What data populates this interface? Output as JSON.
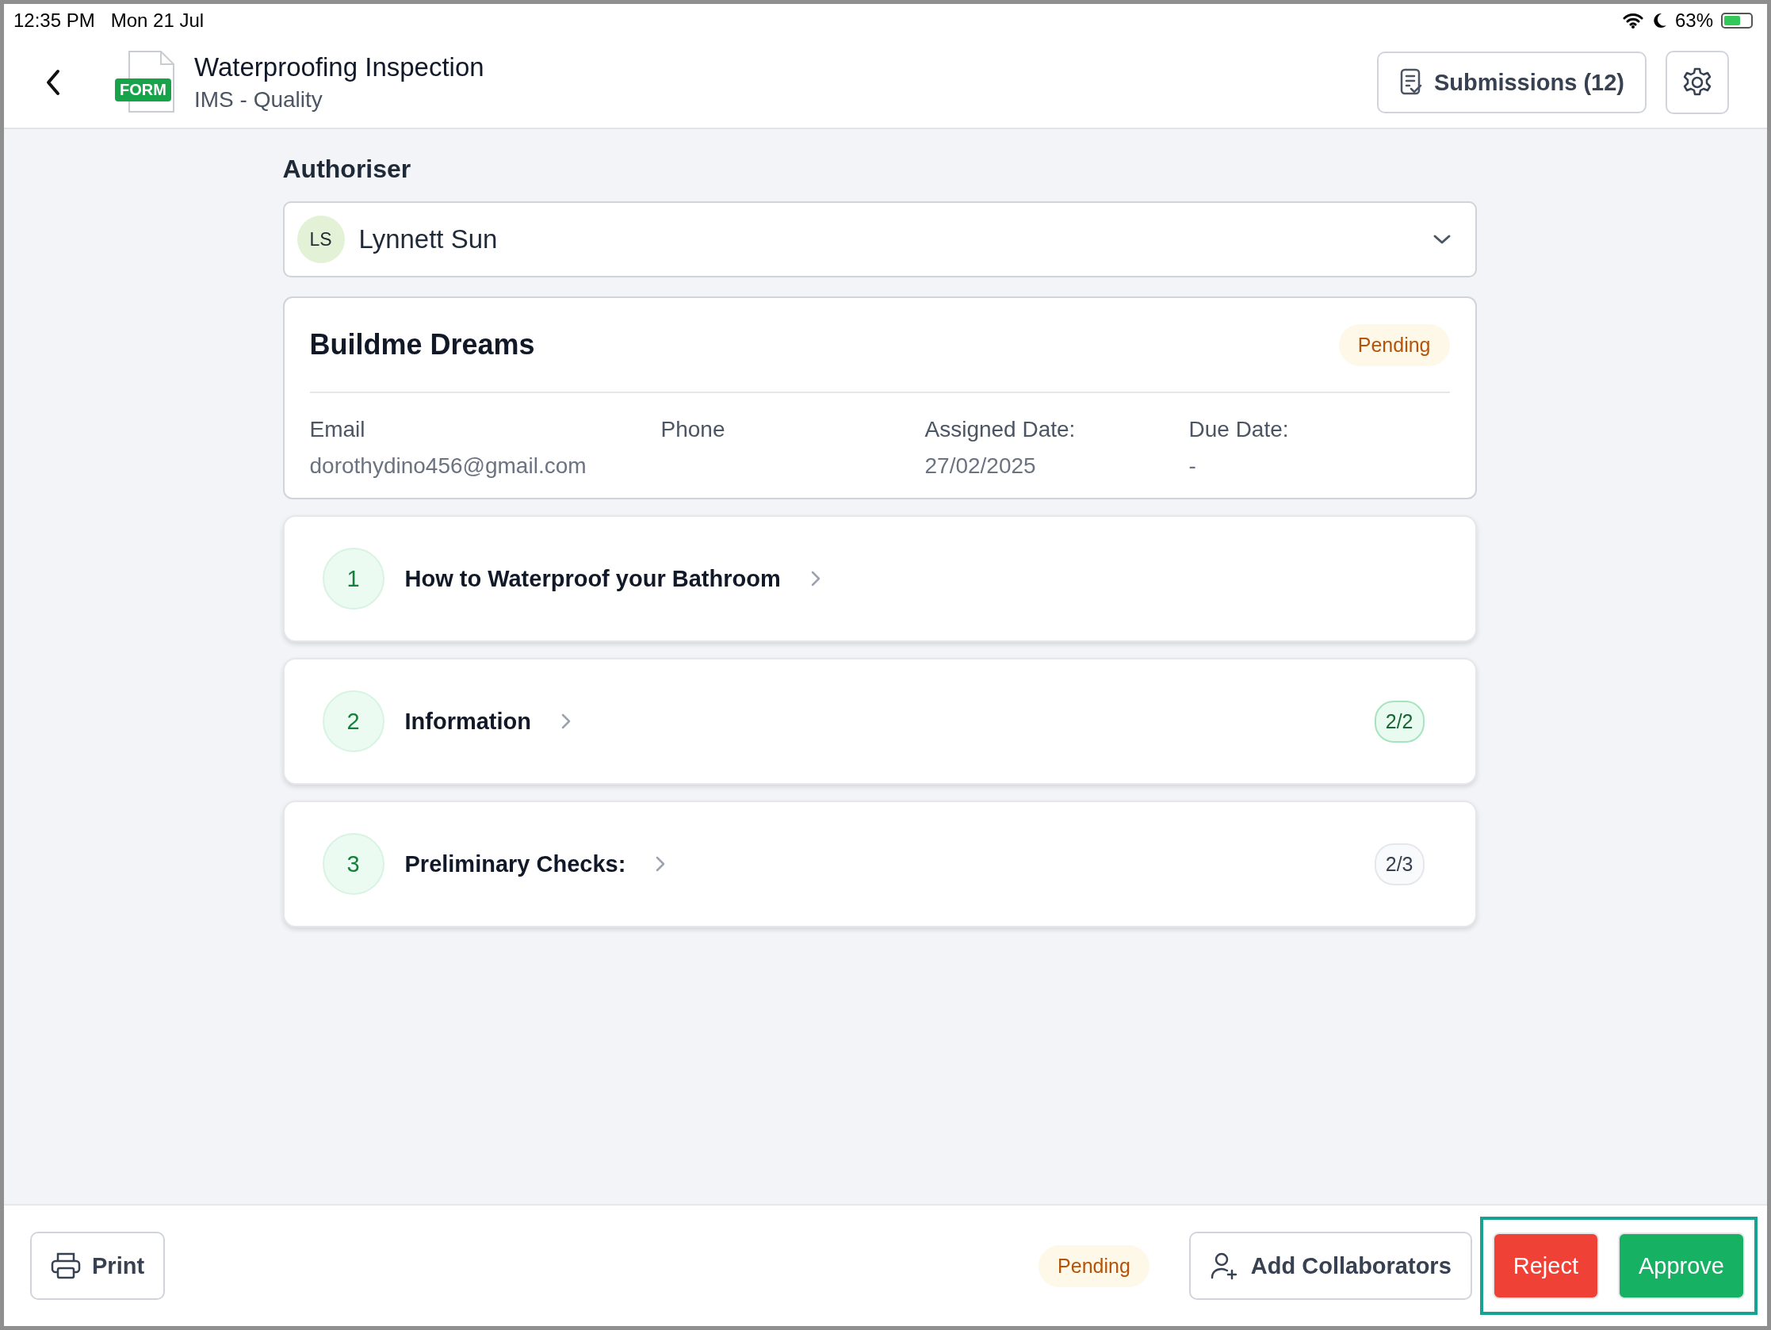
{
  "status_bar": {
    "time": "12:35 PM",
    "date": "Mon 21 Jul",
    "battery": "63%"
  },
  "header": {
    "badge": "FORM",
    "title": "Waterproofing Inspection",
    "subtitle": "IMS - Quality",
    "submissions_button": "Submissions (12)"
  },
  "authoriser": {
    "label": "Authoriser",
    "initials": "LS",
    "name": "Lynnett Sun"
  },
  "assignee_card": {
    "title": "Buildme Dreams",
    "status": "Pending",
    "fields": [
      {
        "label": "Email",
        "value": "dorothydino456@gmail.com"
      },
      {
        "label": "Phone"
      },
      {
        "label": "Assigned Date:",
        "value": "27/02/2025"
      },
      {
        "label": "Due Date:",
        "value": "-"
      }
    ]
  },
  "sections": [
    {
      "number": "1",
      "title": "How to Waterproof your Bathroom"
    },
    {
      "number": "2",
      "title": "Information",
      "progress": "2/2",
      "complete": true
    },
    {
      "number": "3",
      "title": "Preliminary Checks:",
      "progress": "2/3",
      "complete": false
    }
  ],
  "footer": {
    "print_button": "Print",
    "status": "Pending",
    "collaborators_button": "Add Collaborators",
    "reject_button": "Reject",
    "approve_button": "Approve"
  }
}
